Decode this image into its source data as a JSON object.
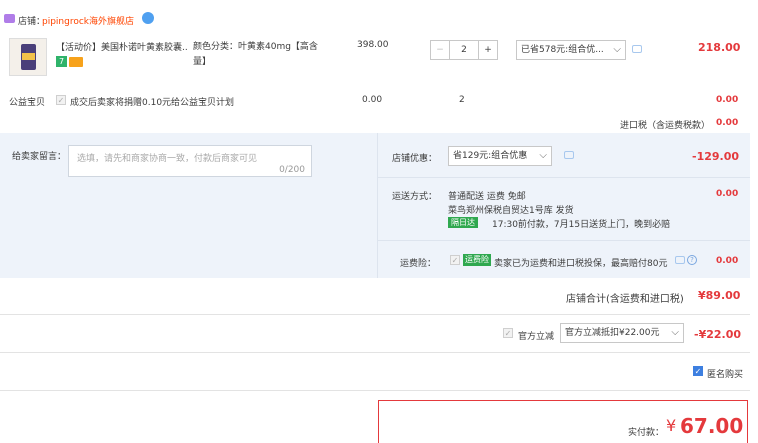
{
  "store": {
    "label": "店铺：",
    "name": "pipingrock海外旗舰店"
  },
  "item": {
    "title": "【活动价】美国朴诺叶黄素胶囊...",
    "spec": "颜色分类：叶黄素40mg【高含量】",
    "price": "398.00",
    "quantity": "2",
    "decrement": "−",
    "increment": "+",
    "promo_select": "已省578元:组合优...",
    "subtotal": "218.00"
  },
  "charity": {
    "label": "公益宝贝",
    "text": "成交后卖家将捐赠0.10元给公益宝贝计划",
    "price": "0.00",
    "qty": "2",
    "total": "0.00"
  },
  "import_tax": {
    "label": "进口税（含运费税款）",
    "value": "0.00"
  },
  "message": {
    "label": "给卖家留言：",
    "placeholder": "选填，请先和商家协商一致，付款后商家可见",
    "counter": "0/200"
  },
  "shop_discount": {
    "label": "店铺优惠：",
    "select": "省129元:组合优惠",
    "value": "-129.00"
  },
  "shipping": {
    "label": "运送方式：",
    "method": "普通配送 运费 免邮",
    "warehouse": "菜鸟郑州保税自贸达1号库  发货",
    "badge": "隔日达",
    "eta": "17:30前付款，7月15日送货上门，晚到必赔",
    "value": "0.00"
  },
  "insurance": {
    "label": "运费险：",
    "badge": "运费险",
    "text": "卖家已为运费和进口税投保，最高赔付80元",
    "value": "0.00"
  },
  "store_total": {
    "label": "店铺合计(含运费和进口税)",
    "value": "¥89.00"
  },
  "official": {
    "label": "官方立减",
    "select": "官方立减抵扣¥22.00元",
    "value": "-¥22.00"
  },
  "anonymous": {
    "label": "匿名购买"
  },
  "pay": {
    "label": "实付款：",
    "currency": "¥",
    "amount": "67.00"
  },
  "colors": {
    "accent": "#e4393c",
    "band": "#eef3fa",
    "brand": "#ff5000"
  }
}
